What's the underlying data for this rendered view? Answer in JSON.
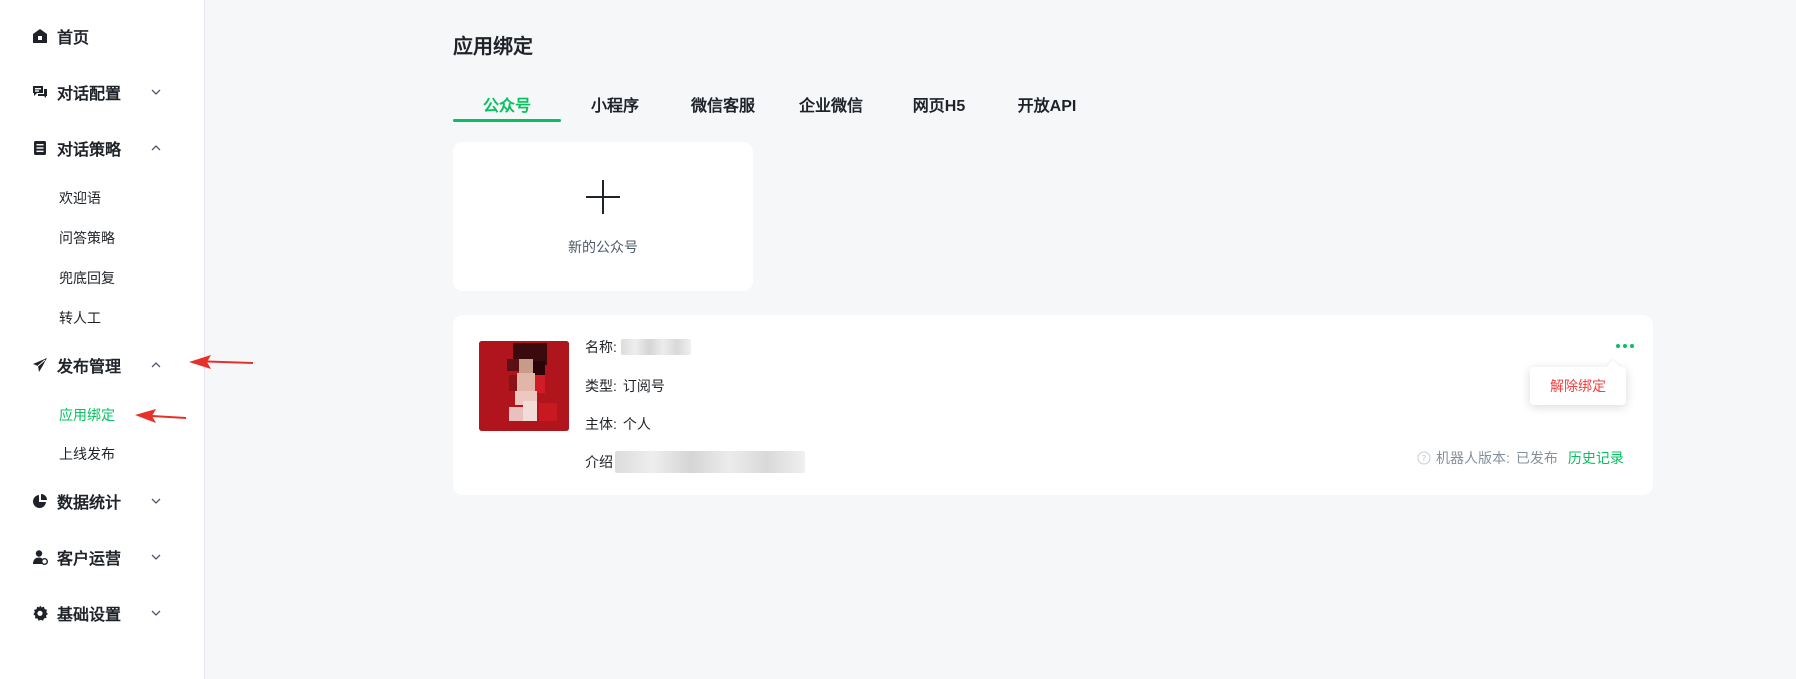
{
  "sidebar": {
    "items": [
      {
        "label": "首页",
        "icon": "home-icon"
      },
      {
        "label": "对话配置",
        "icon": "chat-config-icon"
      },
      {
        "label": "对话策略",
        "icon": "strategy-icon"
      },
      {
        "label": "发布管理",
        "icon": "send-icon"
      },
      {
        "label": "数据统计",
        "icon": "pie-chart-icon"
      },
      {
        "label": "客户运营",
        "icon": "user-operation-icon"
      },
      {
        "label": "基础设置",
        "icon": "gear-icon"
      }
    ],
    "strategy_sub": [
      "欢迎语",
      "问答策略",
      "兜底回复",
      "转人工"
    ],
    "publish_sub": [
      "应用绑定",
      "上线发布"
    ]
  },
  "main": {
    "title": "应用绑定",
    "tabs": [
      "公众号",
      "小程序",
      "微信客服",
      "企业微信",
      "网页H5",
      "开放API"
    ],
    "active_tab": "公众号",
    "add_card_label": "新的公众号",
    "account": {
      "name_key": "名称:",
      "type_key": "类型:",
      "type_value": "订阅号",
      "owner_key": "主体:",
      "owner_value": "个人",
      "intro_key": "介绍",
      "unbind_label": "解除绑定",
      "robot_version_label": "机器人版本:",
      "robot_version_value": "已发布",
      "history_label": "历史记录"
    }
  },
  "colors": {
    "accent": "#07c160",
    "danger": "#f53f3f",
    "arrow": "#e8302a"
  }
}
